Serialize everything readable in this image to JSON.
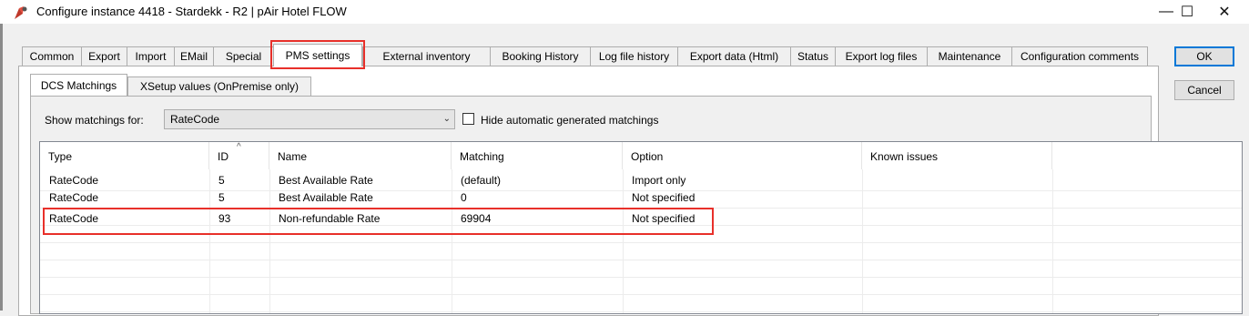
{
  "window": {
    "title": "Configure instance 4418 - Stardekk - R2 | pAir Hotel FLOW",
    "minimize": "—",
    "maximize": "☐",
    "close": "✕"
  },
  "tabs": [
    {
      "label": "Common"
    },
    {
      "label": "Export"
    },
    {
      "label": "Import"
    },
    {
      "label": "EMail"
    },
    {
      "label": "Special"
    },
    {
      "label": "PMS settings"
    },
    {
      "label": "External inventory"
    },
    {
      "label": "Booking History"
    },
    {
      "label": "Log file history"
    },
    {
      "label": "Export data (Html)"
    },
    {
      "label": "Status"
    },
    {
      "label": "Export log files"
    },
    {
      "label": "Maintenance"
    },
    {
      "label": "Configuration comments"
    }
  ],
  "subtabs": [
    {
      "label": "DCS Matchings"
    },
    {
      "label": "XSetup values (OnPremise only)"
    }
  ],
  "filter": {
    "label": "Show matchings for:",
    "selected": "RateCode",
    "hide_auto_label": "Hide automatic generated matchings"
  },
  "grid": {
    "columns": [
      "Type",
      "ID",
      "Name",
      "Matching",
      "Option",
      "Known issues"
    ],
    "rows": [
      [
        "RateCode",
        "5",
        "Best Available Rate",
        "(default)",
        "Import only",
        ""
      ],
      [
        "RateCode",
        "5",
        "Best Available Rate",
        "0",
        "Not specified",
        ""
      ],
      [
        "RateCode",
        "93",
        "Non-refundable Rate",
        "69904",
        "Not specified",
        ""
      ]
    ]
  },
  "buttons": {
    "ok": "OK",
    "cancel": "Cancel"
  },
  "colors": {
    "highlight": "#e8302a",
    "default_button_border": "#0078d7"
  }
}
